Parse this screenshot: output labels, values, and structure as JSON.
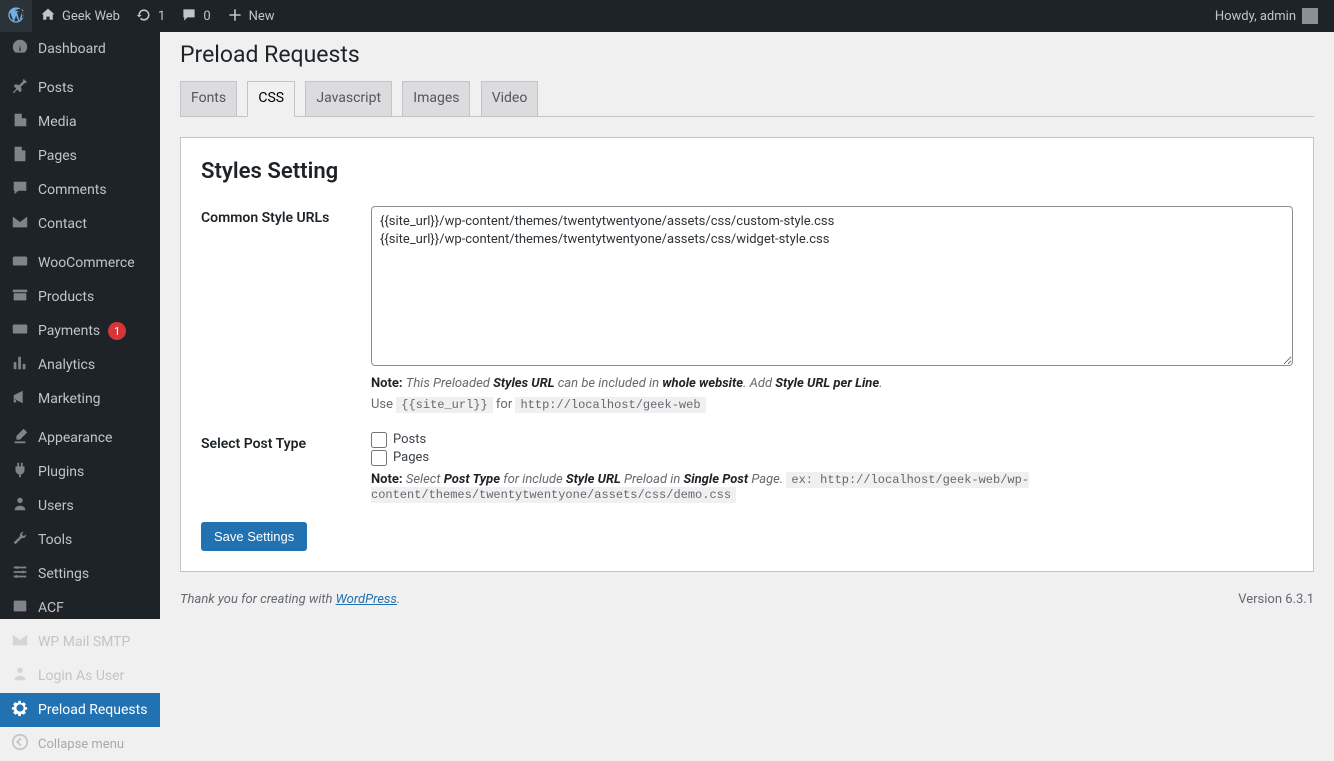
{
  "adminbar": {
    "site_name": "Geek Web",
    "updates": "1",
    "comments": "0",
    "new_label": "New",
    "howdy": "Howdy, admin"
  },
  "sidebar": {
    "items": [
      {
        "label": "Dashboard"
      },
      {
        "label": "Posts"
      },
      {
        "label": "Media"
      },
      {
        "label": "Pages"
      },
      {
        "label": "Comments"
      },
      {
        "label": "Contact"
      },
      {
        "label": "WooCommerce"
      },
      {
        "label": "Products"
      },
      {
        "label": "Payments",
        "badge": "1"
      },
      {
        "label": "Analytics"
      },
      {
        "label": "Marketing"
      },
      {
        "label": "Appearance"
      },
      {
        "label": "Plugins"
      },
      {
        "label": "Users"
      },
      {
        "label": "Tools"
      },
      {
        "label": "Settings"
      },
      {
        "label": "ACF"
      },
      {
        "label": "WP Mail SMTP"
      },
      {
        "label": "Login As User"
      },
      {
        "label": "Preload Requests"
      }
    ],
    "collapse_label": "Collapse menu"
  },
  "page": {
    "title": "Preload Requests",
    "tabs": [
      "Fonts",
      "CSS",
      "Javascript",
      "Images",
      "Video"
    ],
    "active_tab": 1,
    "section_heading": "Styles Setting",
    "common_urls_label": "Common Style URLs",
    "textarea_value": "{{site_url}}/wp-content/themes/twentytwentyone/assets/css/custom-style.css\n{{site_url}}/wp-content/themes/twentytwentyone/assets/css/widget-style.css",
    "note_label": "Note:",
    "note1_prefix": "This Preloaded ",
    "note1_b1": "Styles URL",
    "note1_mid": " can be included in ",
    "note1_b2": "whole website",
    "note1_mid2": ". Add ",
    "note1_b3": "Style URL per Line",
    "note1_end": ".",
    "use_text": "Use ",
    "use_code": "{{site_url}}",
    "use_for": " for ",
    "use_example": "http://localhost/geek-web",
    "select_post_type_label": "Select Post Type",
    "checkbox_posts": "Posts",
    "checkbox_pages": "Pages",
    "note2_prefix": "Select ",
    "note2_b1": "Post Type",
    "note2_mid": " for include ",
    "note2_b2": "Style URL",
    "note2_mid2": " Preload in ",
    "note2_b3": "Single Post",
    "note2_end": " Page. ",
    "note2_code": "ex: http://localhost/geek-web/wp-content/themes/twentytwentyone/assets/css/demo.css",
    "save_label": "Save Settings"
  },
  "footer": {
    "thank_prefix": "Thank you for creating with ",
    "link_text": "WordPress",
    "thank_suffix": ".",
    "version": "Version 6.3.1"
  }
}
